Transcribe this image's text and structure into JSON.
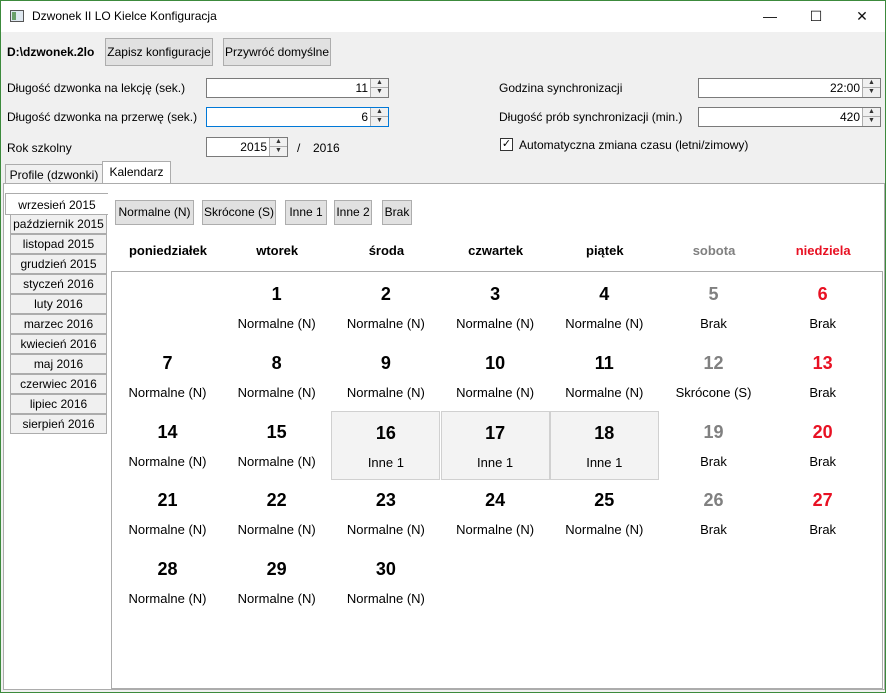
{
  "window": {
    "title": "Dzwonek II LO Kielce Konfiguracja",
    "minimize": "—",
    "maximize": "☐",
    "close": "✕"
  },
  "toolbar": {
    "file": "D:\\dzwonek.2lo",
    "save_label": "Zapisz konfiguracje",
    "restore_label": "Przywróć domyślne"
  },
  "settings": {
    "lesson_bell_label": "Długość dzwonka na lekcję (sek.)",
    "lesson_bell_value": "11",
    "break_bell_label": "Długość dzwonka na przerwę (sek.)",
    "break_bell_value": "6",
    "school_year_label": "Rok szkolny",
    "school_year_value": "2015",
    "school_year_sep": "/",
    "school_year_end": "2016",
    "sync_time_label": "Godzina synchronizacji",
    "sync_time_value": "22:00",
    "sync_length_label": "Długość prób synchronizacji (min.)",
    "sync_length_value": "420",
    "auto_dst_label": "Automatyczna zmiana czasu (letni/zimowy)",
    "auto_dst_checked": "✓"
  },
  "tabs": [
    "Profile (dzwonki)",
    "Kalendarz"
  ],
  "months": [
    "wrzesień 2015",
    "październik 2015",
    "listopad 2015",
    "grudzień 2015",
    "styczeń 2016",
    "luty 2016",
    "marzec 2016",
    "kwiecień 2016",
    "maj 2016",
    "czerwiec 2016",
    "lipiec 2016",
    "sierpień 2016"
  ],
  "legend": [
    "Normalne (N)",
    "Skrócone (S)",
    "Inne 1",
    "Inne 2",
    "Brak"
  ],
  "weekdays": [
    "poniedziałek",
    "wtorek",
    "środa",
    "czwartek",
    "piątek",
    "sobota",
    "niedziela"
  ],
  "colors": {
    "saturday": "#808080",
    "sunday": "#e81123"
  },
  "days": [
    {
      "d": "1",
      "t": "Normalne (N)"
    },
    {
      "d": "2",
      "t": "Normalne (N)"
    },
    {
      "d": "3",
      "t": "Normalne (N)"
    },
    {
      "d": "4",
      "t": "Normalne (N)"
    },
    {
      "d": "5",
      "t": "Brak"
    },
    {
      "d": "6",
      "t": "Brak"
    },
    {
      "d": "7",
      "t": "Normalne (N)"
    },
    {
      "d": "8",
      "t": "Normalne (N)"
    },
    {
      "d": "9",
      "t": "Normalne (N)"
    },
    {
      "d": "10",
      "t": "Normalne (N)"
    },
    {
      "d": "11",
      "t": "Normalne (N)"
    },
    {
      "d": "12",
      "t": "Skrócone (S)"
    },
    {
      "d": "13",
      "t": "Brak"
    },
    {
      "d": "14",
      "t": "Normalne (N)"
    },
    {
      "d": "15",
      "t": "Normalne (N)"
    },
    {
      "d": "16",
      "t": "Inne 1"
    },
    {
      "d": "17",
      "t": "Inne 1"
    },
    {
      "d": "18",
      "t": "Inne 1"
    },
    {
      "d": "19",
      "t": "Brak"
    },
    {
      "d": "20",
      "t": "Brak"
    },
    {
      "d": "21",
      "t": "Normalne (N)"
    },
    {
      "d": "22",
      "t": "Normalne (N)"
    },
    {
      "d": "23",
      "t": "Normalne (N)"
    },
    {
      "d": "24",
      "t": "Normalne (N)"
    },
    {
      "d": "25",
      "t": "Normalne (N)"
    },
    {
      "d": "26",
      "t": "Brak"
    },
    {
      "d": "27",
      "t": "Brak"
    },
    {
      "d": "28",
      "t": "Normalne (N)"
    },
    {
      "d": "29",
      "t": "Normalne (N)"
    },
    {
      "d": "30",
      "t": "Normalne (N)"
    }
  ]
}
